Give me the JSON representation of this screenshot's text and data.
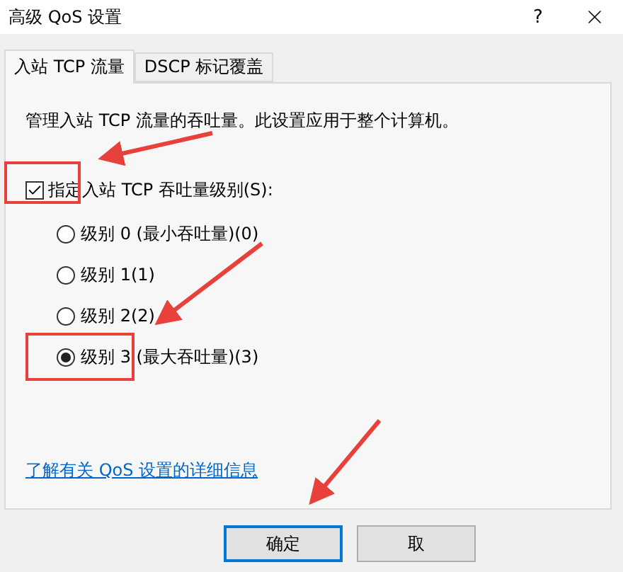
{
  "window": {
    "title": "高级 QoS 设置",
    "help": "?"
  },
  "tabs": [
    {
      "label": "入站 TCP 流量",
      "selected": true
    },
    {
      "label": "DSCP 标记覆盖",
      "selected": false
    }
  ],
  "description": "管理入站 TCP 流量的吞吐量。此设置应用于整个计算机。",
  "specify_level": {
    "label": "指定入站 TCP 吞吐量级别(S):",
    "checked": true
  },
  "levels": [
    {
      "label": "级别 0 (最小吞吐量)(0)",
      "selected": false
    },
    {
      "label": "级别 1(1)",
      "selected": false
    },
    {
      "label": "级别 2(2)",
      "selected": false
    },
    {
      "label": "级别 3 (最大吞吐量)(3)",
      "selected": true
    }
  ],
  "link": "了解有关 QoS 设置的详细信息",
  "buttons": [
    {
      "label": "确定",
      "default": true
    },
    {
      "label": "取",
      "default": false
    }
  ]
}
